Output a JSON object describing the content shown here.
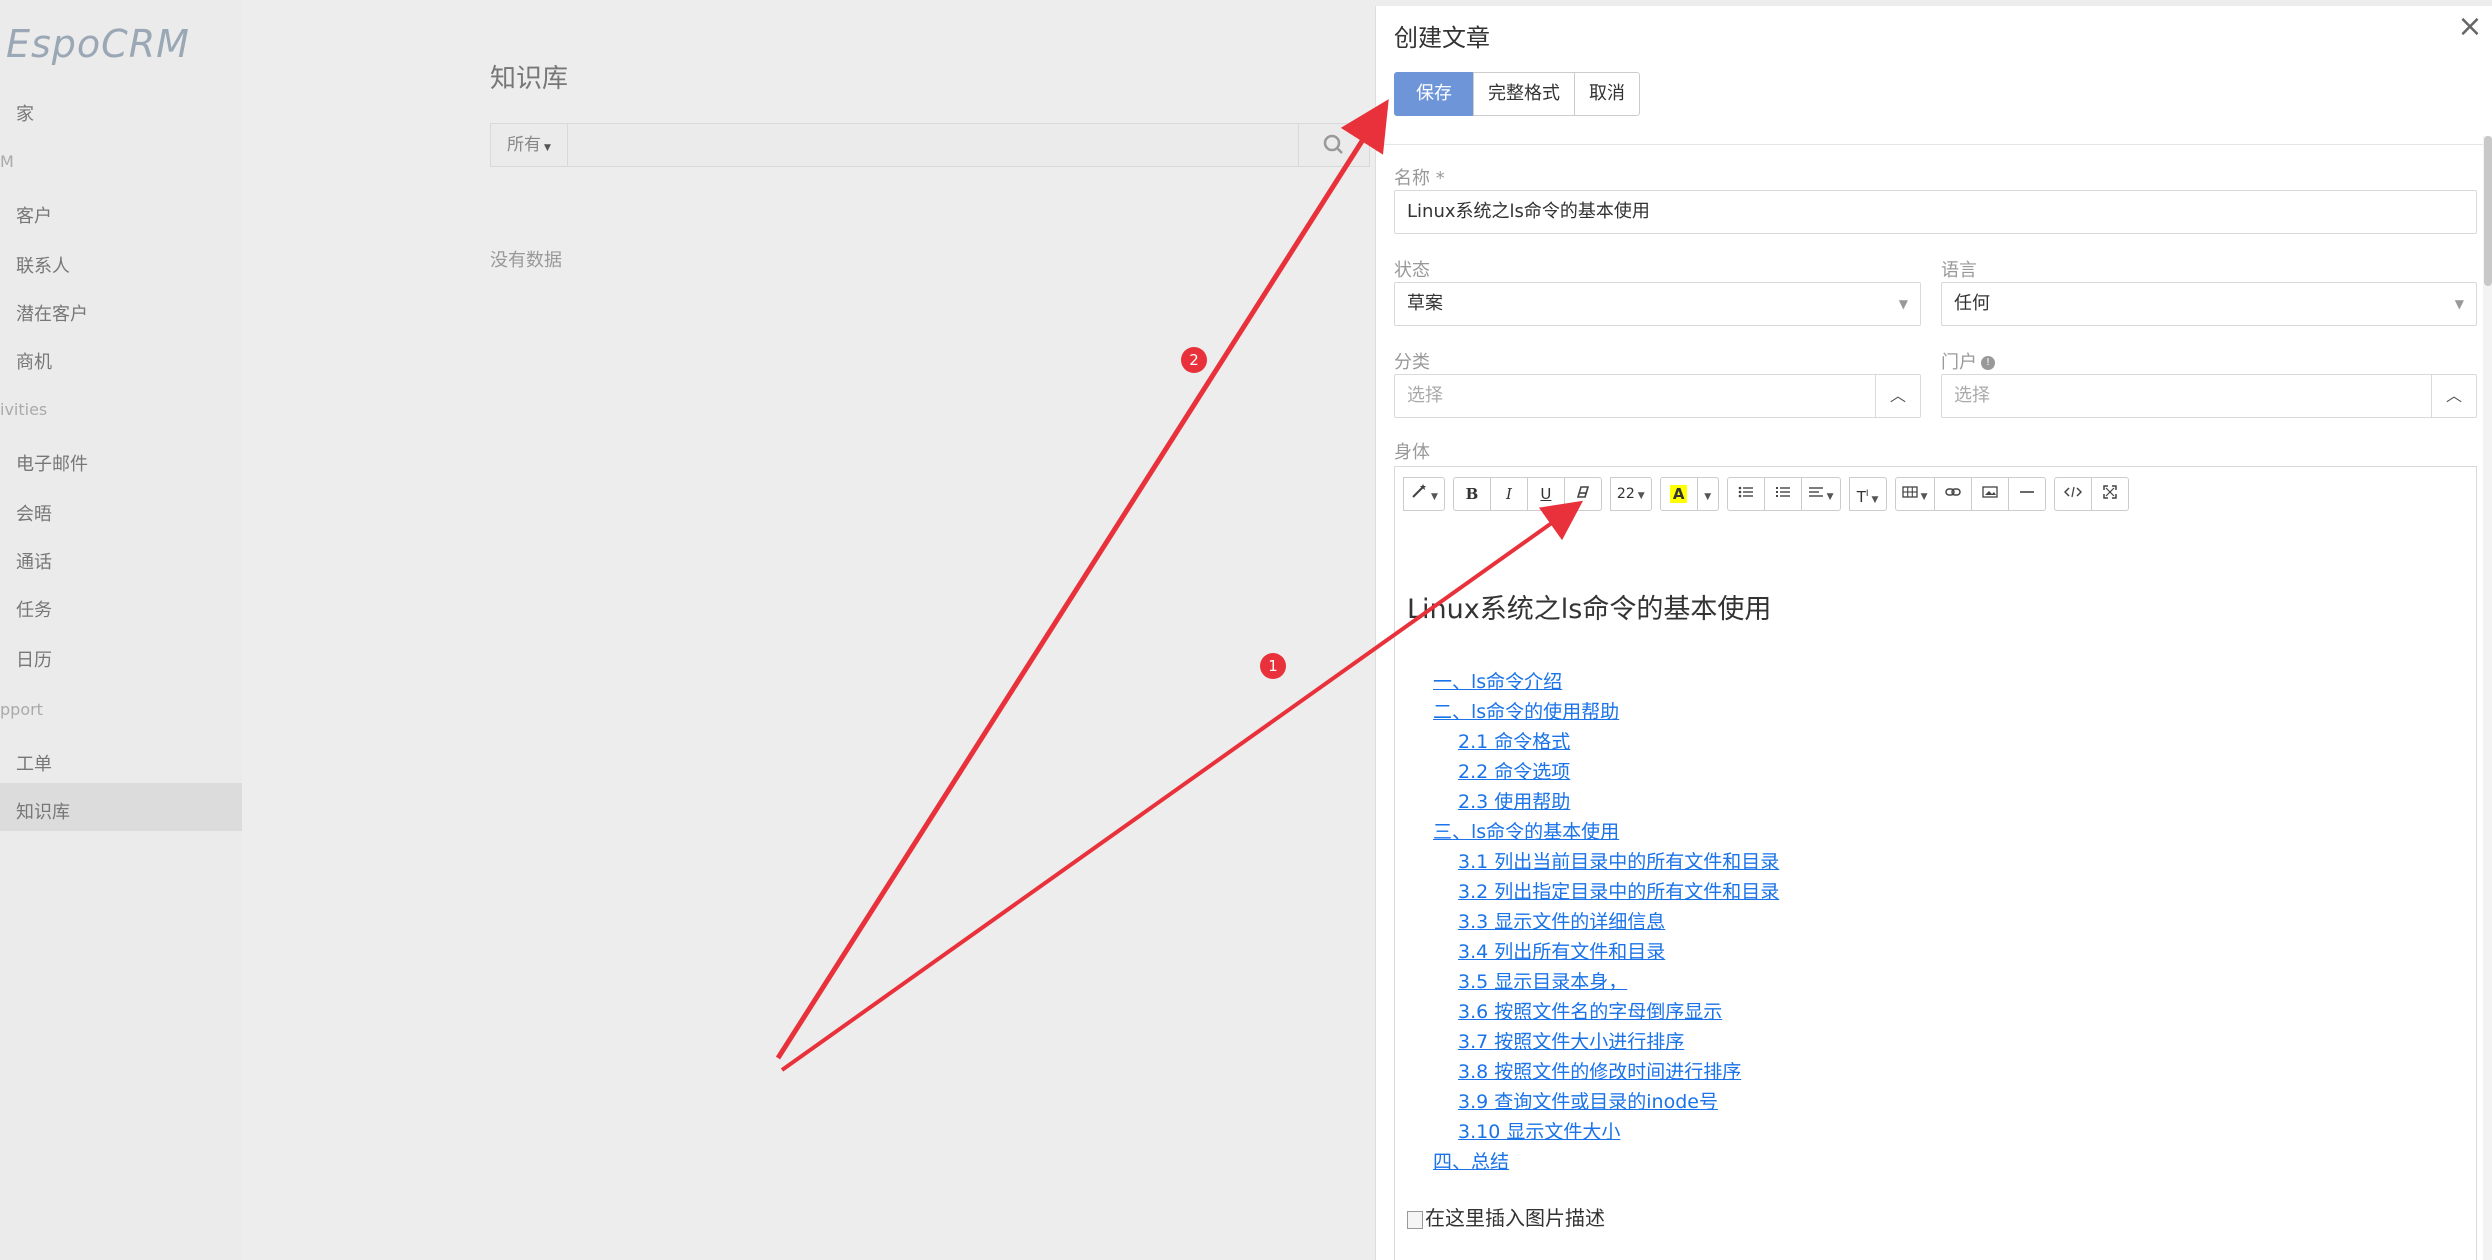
{
  "app": {
    "logo_text": "EspoCRM",
    "nav": [
      {
        "label": "家"
      },
      {
        "label": "M",
        "group": true
      },
      {
        "label": "客户"
      },
      {
        "label": "联系人"
      },
      {
        "label": "潜在客户"
      },
      {
        "label": "商机"
      },
      {
        "label": "ivities",
        "group": true
      },
      {
        "label": "电子邮件"
      },
      {
        "label": "会晤"
      },
      {
        "label": "通话"
      },
      {
        "label": "任务"
      },
      {
        "label": "日历"
      },
      {
        "label": "pport",
        "group": true
      },
      {
        "label": "工单"
      },
      {
        "label": "知识库",
        "active": true
      }
    ],
    "main_title": "知识库",
    "filter_label": "所有",
    "no_data": "没有数据"
  },
  "panel": {
    "title": "创建文章",
    "buttons": {
      "save": "保存",
      "full_form": "完整格式",
      "cancel": "取消"
    },
    "close_icon": "×",
    "fields": {
      "name_label": "名称",
      "name_required": "*",
      "name_value": "Linux系统之ls命令的基本使用",
      "status_label": "状态",
      "status_value": "草案",
      "language_label": "语言",
      "language_value": "任何",
      "category_label": "分类",
      "category_placeholder": "选择",
      "portal_label": "门户",
      "portal_placeholder": "选择",
      "body_label": "身体"
    },
    "toolbar": {
      "style": "",
      "bold": "B",
      "italic": "I",
      "underline": "U",
      "clear": "",
      "font_size": "22",
      "color_letter": "A",
      "line_height": "T",
      "line_height_sup": "I"
    },
    "document": {
      "title": "Linux系统之ls命令的基本使用",
      "toc": [
        {
          "text": "一、ls命令介绍",
          "level": 1
        },
        {
          "text": "二、ls命令的使用帮助",
          "level": 1
        },
        {
          "text": "2.1 命令格式",
          "level": 2
        },
        {
          "text": "2.2 命令选项",
          "level": 2
        },
        {
          "text": "2.3 使用帮助",
          "level": 2
        },
        {
          "text": "三、ls命令的基本使用",
          "level": 1
        },
        {
          "text": "3.1 列出当前目录中的所有文件和目录",
          "level": 2
        },
        {
          "text": "3.2 列出指定目录中的所有文件和目录",
          "level": 2
        },
        {
          "text": "3.3 显示文件的详细信息",
          "level": 2
        },
        {
          "text": "3.4 列出所有文件和目录",
          "level": 2
        },
        {
          "text": "3.5 显示目录本身，",
          "level": 2
        },
        {
          "text": "3.6 按照文件名的字母倒序显示",
          "level": 2
        },
        {
          "text": "3.7 按照文件大小进行排序",
          "level": 2
        },
        {
          "text": "3.8 按照文件的修改时间进行排序",
          "level": 2
        },
        {
          "text": "3.9 查询文件或目录的inode号",
          "level": 2
        },
        {
          "text": "3.10 显示文件大小",
          "level": 2
        },
        {
          "text": "四、总结",
          "level": 1
        }
      ],
      "image_alt": "在这里插入图片描述"
    }
  },
  "annotations": {
    "badge1": "1",
    "badge2": "2",
    "color": "#e8313a"
  }
}
